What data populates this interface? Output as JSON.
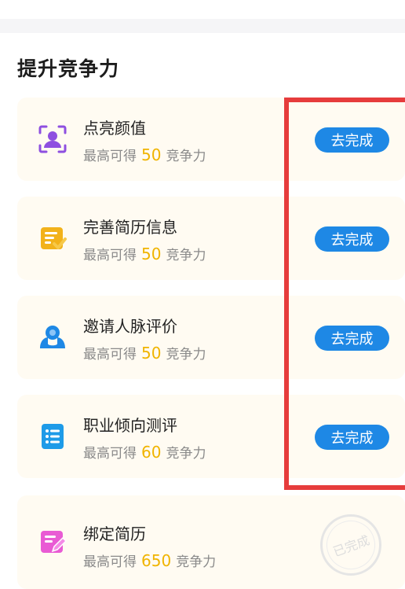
{
  "section_title": "提升竞争力",
  "tasks": [
    {
      "title": "点亮颜值",
      "sub_prefix": "最高可得",
      "points": "50",
      "sub_suffix": "竞争力",
      "action": "去完成",
      "icon": "portrait-frame-icon",
      "icon_color": "#8e4fe0"
    },
    {
      "title": "完善简历信息",
      "sub_prefix": "最高可得",
      "points": "50",
      "sub_suffix": "竞争力",
      "action": "去完成",
      "icon": "resume-check-icon",
      "icon_color": "#f2b21b"
    },
    {
      "title": "邀请人脉评价",
      "sub_prefix": "最高可得",
      "points": "50",
      "sub_suffix": "竞争力",
      "action": "去完成",
      "icon": "people-icon",
      "icon_color": "#1e88e5"
    },
    {
      "title": "职业倾向测评",
      "sub_prefix": "最高可得",
      "points": "60",
      "sub_suffix": "竞争力",
      "action": "去完成",
      "icon": "list-icon",
      "icon_color": "#1e9be8"
    },
    {
      "title": "绑定简历",
      "sub_prefix": "最高可得",
      "points": "650",
      "sub_suffix": "竞争力",
      "status": "已完成",
      "icon": "edit-document-icon",
      "icon_color": "#e95bd4"
    }
  ],
  "colors": {
    "accent": "#1e88e5",
    "points": "#f0b400",
    "card_bg": "#fffbf2",
    "highlight": "#e63c3c"
  }
}
